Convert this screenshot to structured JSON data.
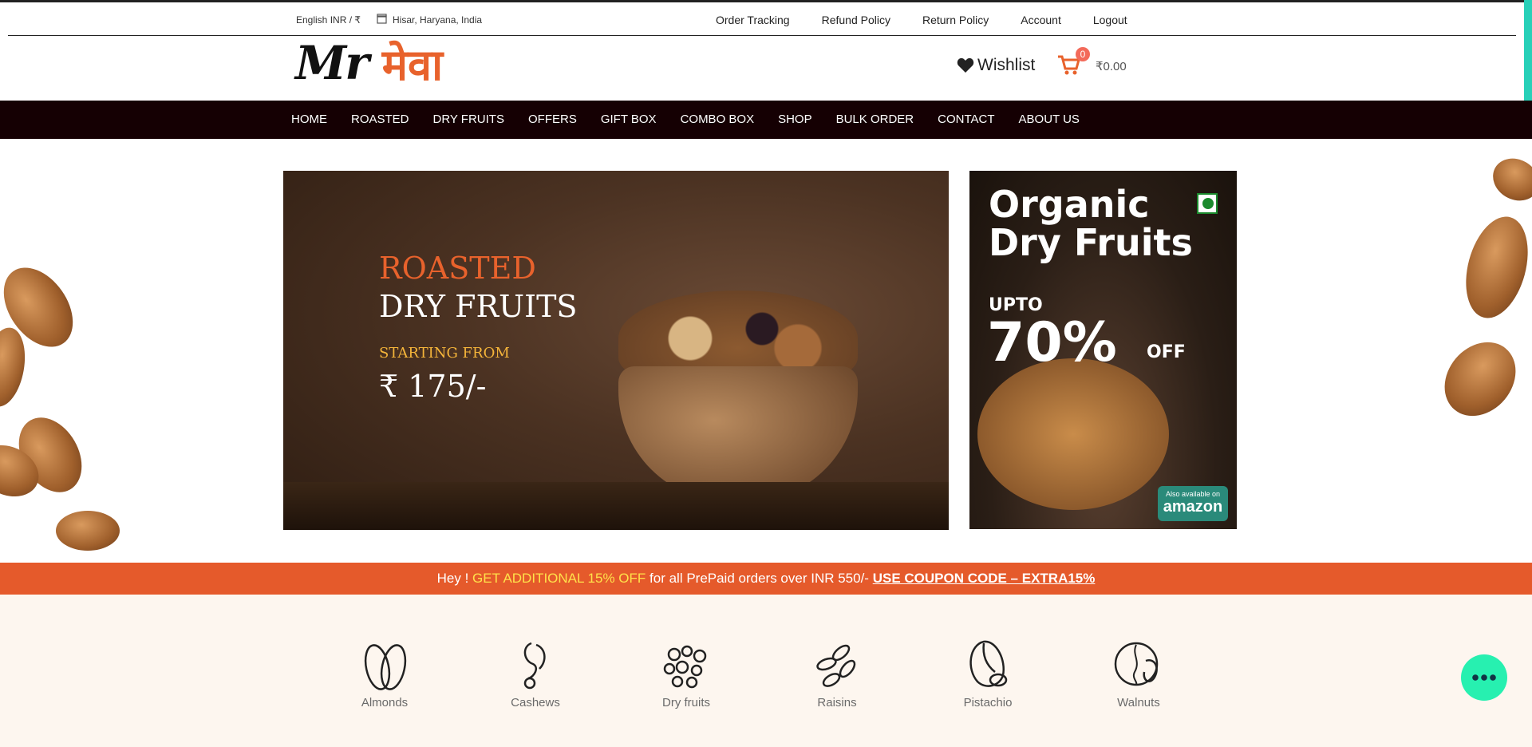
{
  "topbar": {
    "locale": "English INR / ₹",
    "location": "Hisar, Haryana, India",
    "links": [
      "Order Tracking",
      "Refund Policy",
      "Return Policy",
      "Account",
      "Logout"
    ]
  },
  "header": {
    "logo_latin": "Mr",
    "logo_hindi": "मेवा",
    "wishlist_label": "Wishlist",
    "cart_count": "0",
    "cart_total": "₹0.00"
  },
  "nav": {
    "items": [
      "HOME",
      "ROASTED",
      "DRY FRUITS",
      "OFFERS",
      "GIFT BOX",
      "COMBO BOX",
      "SHOP",
      "BULK ORDER",
      "CONTACT",
      "ABOUT US"
    ]
  },
  "hero": {
    "line1": "ROASTED",
    "line2": "DRY FRUITS",
    "line3": "STARTING FROM",
    "price": "₹ 175/-"
  },
  "promo": {
    "title": "Organic Dry Fruits",
    "upto": "UPTO",
    "percent": "70%",
    "off": "OFF",
    "amazon_small": "Also available on",
    "amazon": "amazon"
  },
  "coupon": {
    "lead": "Hey ! ",
    "highlight": "GET ADDITIONAL 15% OFF",
    "middle": " for all PrePaid orders over INR 550/- ",
    "code": "USE COUPON CODE – EXTRA15%"
  },
  "categories": [
    "Almonds",
    "Cashews",
    "Dry fruits",
    "Raisins",
    "Pistachio",
    "Walnuts"
  ],
  "colors": {
    "accent": "#e8622c",
    "nav_bg": "#150003",
    "chat": "#27f0b0"
  }
}
